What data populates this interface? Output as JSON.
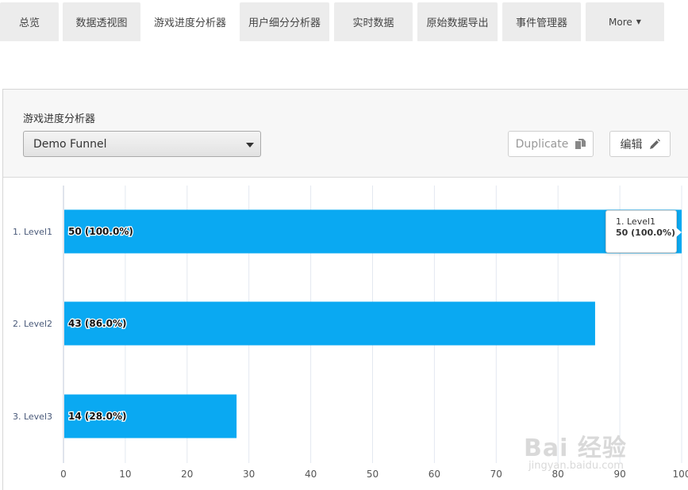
{
  "tabs": [
    {
      "label": "总览",
      "active": false
    },
    {
      "label": "数据透视图",
      "active": false
    },
    {
      "label": "游戏进度分析器",
      "active": true
    },
    {
      "label": "用户细分分析器",
      "active": false
    },
    {
      "label": "实时数据",
      "active": false
    },
    {
      "label": "原始数据导出",
      "active": false
    },
    {
      "label": "事件管理器",
      "active": false
    },
    {
      "label": "More",
      "active": false
    }
  ],
  "panel": {
    "title": "游戏进度分析器",
    "funnel_select": {
      "value": "Demo Funnel"
    },
    "duplicate_label": "Duplicate",
    "edit_label": "编辑"
  },
  "chart_data": {
    "type": "bar",
    "orientation": "horizontal",
    "categories": [
      "1. Level1",
      "2. Level2",
      "3. Level3"
    ],
    "values": [
      50,
      43,
      14
    ],
    "data_labels": [
      "50 (100.0%)",
      "43 (86.0%)",
      "14 (28.0%)"
    ],
    "xlim": [
      0,
      100
    ],
    "xticks": [
      0,
      10,
      20,
      30,
      40,
      50,
      60,
      70,
      80,
      90,
      100
    ],
    "grid": true,
    "bar_color": "#0aa9f2",
    "xmax_value": 50,
    "tooltip": {
      "label": "1. Level1",
      "value": "50 (100.0%)"
    }
  },
  "watermark": {
    "logo": "Bai 经验",
    "url": "jingyan.baidu.com"
  },
  "icons": {
    "duplicate": "copy-icon",
    "edit": "pencil-icon",
    "more": "chevron-down-icon",
    "select": "caret-down-icon"
  }
}
